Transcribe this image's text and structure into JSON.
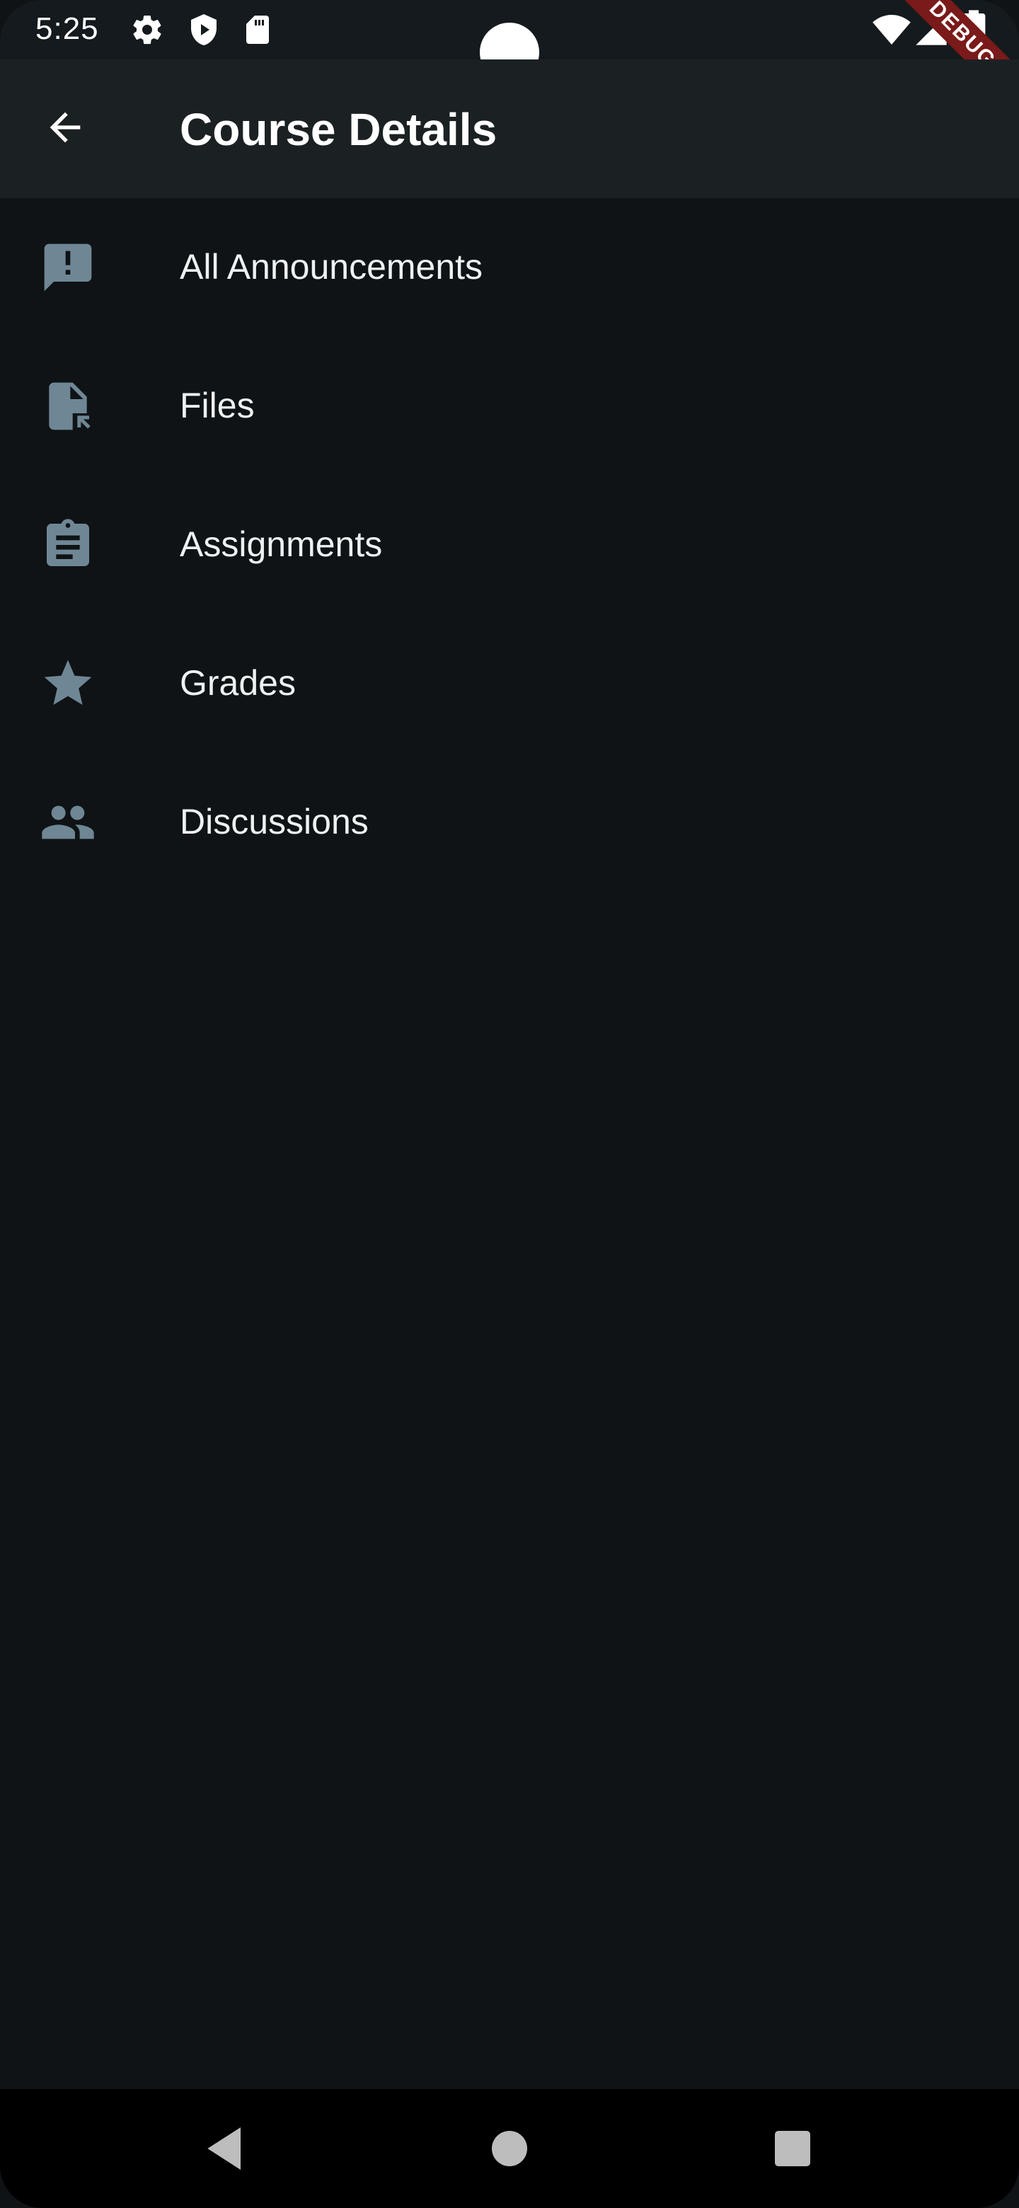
{
  "status_bar": {
    "time": "5:25",
    "icons": [
      "settings-icon",
      "play-protect-icon",
      "sd-card-icon",
      "wifi-icon",
      "cell-signal-icon",
      "battery-icon"
    ],
    "debug_banner": "DEBUG"
  },
  "app_bar": {
    "back_icon": "arrow-back-icon",
    "title": "Course Details"
  },
  "menu": {
    "icon_color": "#6f8795",
    "items": [
      {
        "label": "All Announcements",
        "icon": "announcement-icon"
      },
      {
        "label": "Files",
        "icon": "file-icon"
      },
      {
        "label": "Assignments",
        "icon": "assignment-icon"
      },
      {
        "label": "Grades",
        "icon": "star-icon"
      },
      {
        "label": "Discussions",
        "icon": "people-icon"
      }
    ]
  },
  "nav_bar": {
    "buttons": [
      "back-triangle-icon",
      "home-circle-icon",
      "recents-square-icon"
    ]
  },
  "colors": {
    "background": "#0f1316",
    "app_bar": "#1b2123",
    "text": "#eef1f2",
    "icon": "#6f8795",
    "debug_banner": "#7a1a1a"
  }
}
